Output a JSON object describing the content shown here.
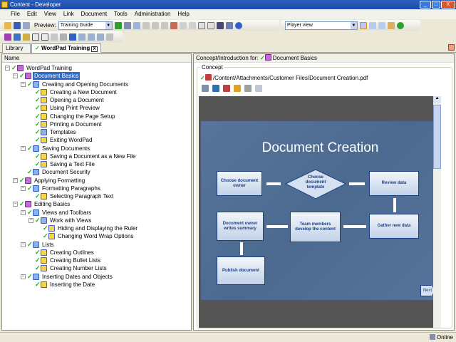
{
  "window": {
    "title": "Content - Developer"
  },
  "menu": [
    "File",
    "Edit",
    "View",
    "Link",
    "Document",
    "Tools",
    "Administration",
    "Help"
  ],
  "toolbar": {
    "preview_label": "Preview:",
    "preview_value": "Training Guide",
    "view_value": "Player view"
  },
  "tabs": [
    {
      "label": "Library"
    },
    {
      "label": "WordPad Training"
    }
  ],
  "tree": {
    "header": "Name",
    "items": [
      {
        "label": "WordPad Training",
        "level": 0,
        "icon": "book"
      },
      {
        "label": "Document Basics",
        "level": 1,
        "icon": "book",
        "selected": true
      },
      {
        "label": "Creating and Opening Documents",
        "level": 2,
        "icon": "bookb"
      },
      {
        "label": "Creating a New Document",
        "level": 3,
        "icon": "topic"
      },
      {
        "label": "Opening a Document",
        "level": 3,
        "icon": "topic"
      },
      {
        "label": "Using Print Preview",
        "level": 3,
        "icon": "topic"
      },
      {
        "label": "Changing the Page Setup",
        "level": 3,
        "icon": "topic"
      },
      {
        "label": "Printing a Document",
        "level": 3,
        "icon": "topic"
      },
      {
        "label": "Templates",
        "level": 3,
        "icon": "bookb"
      },
      {
        "label": "Exiting WordPad",
        "level": 3,
        "icon": "topic"
      },
      {
        "label": "Saving Documents",
        "level": 2,
        "icon": "bookb"
      },
      {
        "label": "Saving a Document as a New File",
        "level": 3,
        "icon": "topic"
      },
      {
        "label": "Saving a Text File",
        "level": 3,
        "icon": "topic"
      },
      {
        "label": "Document Security",
        "level": 2,
        "icon": "bookb"
      },
      {
        "label": "Applying Formatting",
        "level": 1,
        "icon": "book"
      },
      {
        "label": "Formatting Paragraphs",
        "level": 2,
        "icon": "bookb"
      },
      {
        "label": "Selecting Paragraph Text",
        "level": 3,
        "icon": "topic"
      },
      {
        "label": "Editing Basics",
        "level": 1,
        "icon": "book"
      },
      {
        "label": "Views and Toolbars",
        "level": 2,
        "icon": "bookb"
      },
      {
        "label": "Work with Views",
        "level": 3,
        "icon": "bookb"
      },
      {
        "label": "Hiding and Displaying the Ruler",
        "level": 4,
        "icon": "topic"
      },
      {
        "label": "Changing Word Wrap Options",
        "level": 4,
        "icon": "topic"
      },
      {
        "label": "Lists",
        "level": 2,
        "icon": "bookb"
      },
      {
        "label": "Creating Outlines",
        "level": 3,
        "icon": "topic"
      },
      {
        "label": "Creating Bullet Lists",
        "level": 3,
        "icon": "topic"
      },
      {
        "label": "Creating Number Lists",
        "level": 3,
        "icon": "topic"
      },
      {
        "label": "Inserting Dates and Objects",
        "level": 2,
        "icon": "bookb"
      },
      {
        "label": "Inserting the Date",
        "level": 3,
        "icon": "topic"
      }
    ]
  },
  "concept": {
    "header_label": "Concept/Introduction for:",
    "header_item": "Document Basics",
    "group_label": "Concept",
    "path": "/Content/Attachments/Customer Files/Document Creation.pdf"
  },
  "slide": {
    "title": "Document Creation",
    "boxes": {
      "owner": "Choose document owner",
      "template": "Choose document template",
      "review": "Review data",
      "gather": "Gather new data",
      "team": "Team members develop the content",
      "summary": "Document owner writes summary",
      "publish": "Publish document"
    },
    "next": "Next"
  },
  "status": {
    "text": "Online"
  }
}
